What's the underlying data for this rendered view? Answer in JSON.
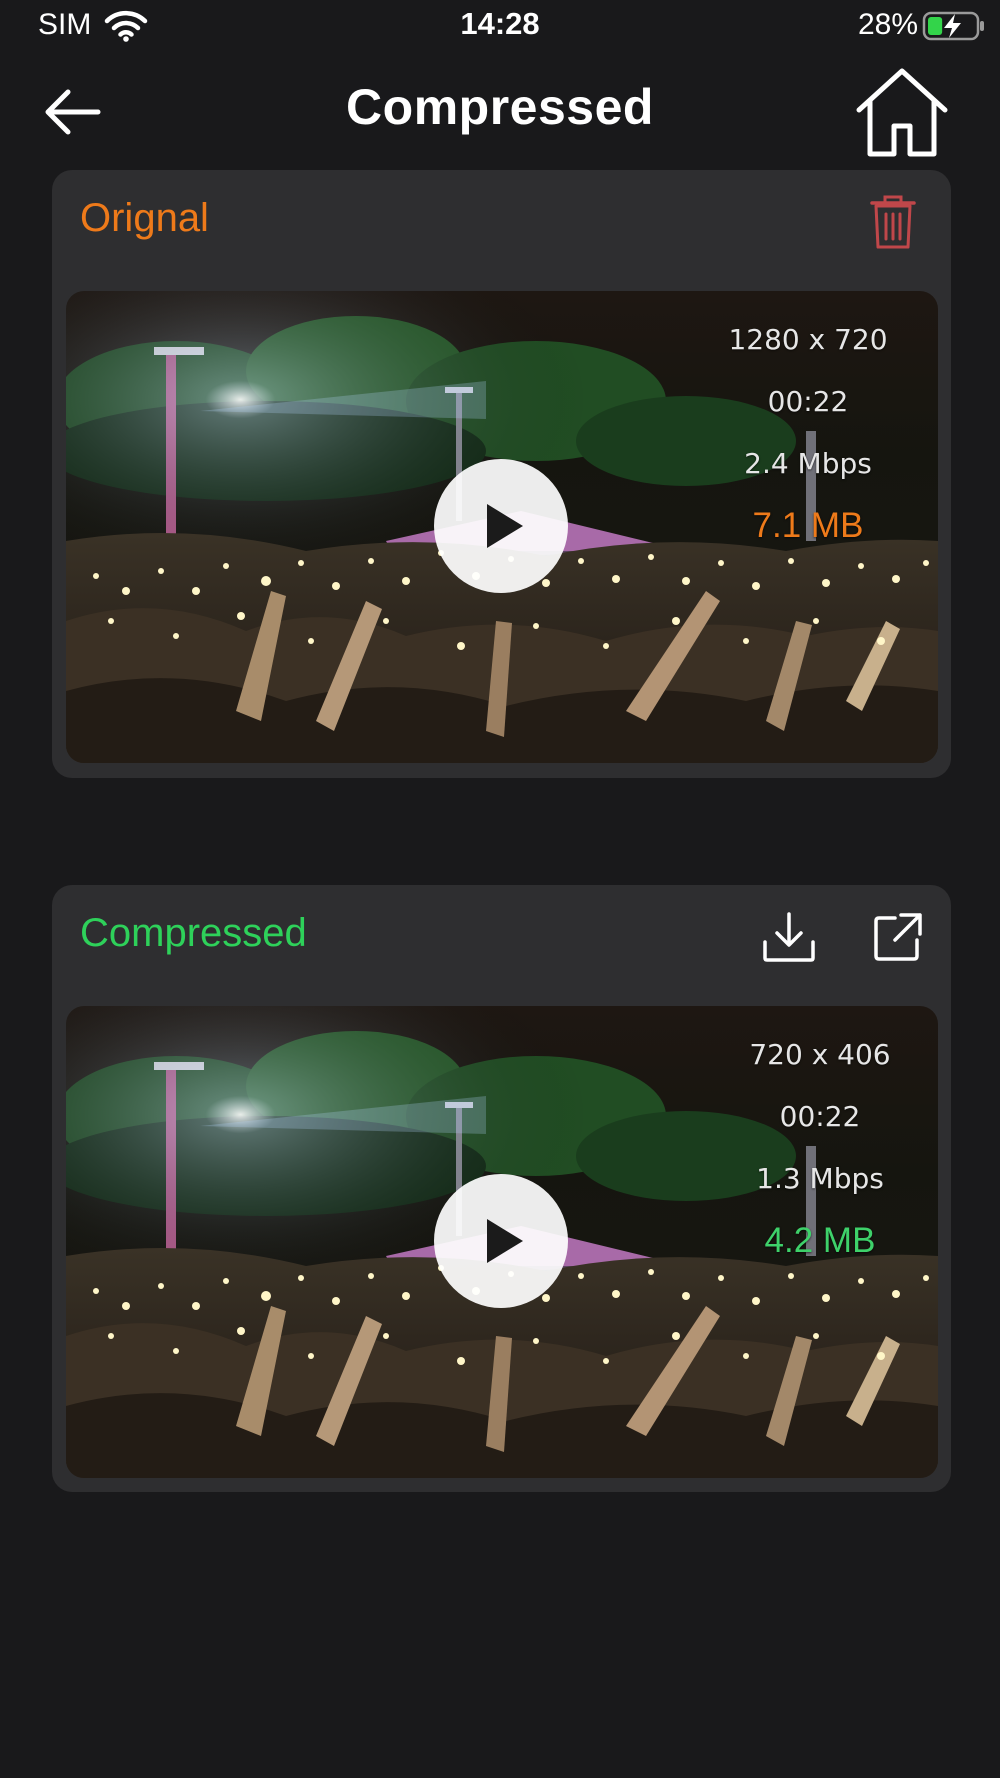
{
  "status_bar": {
    "carrier": "SIM",
    "time": "14:28",
    "battery_percent": "28%",
    "battery_level": 0.28,
    "charging": true
  },
  "nav": {
    "title": "Compressed",
    "back_icon": "arrow-left-icon",
    "home_icon": "home-icon"
  },
  "original": {
    "title": "Orignal",
    "title_color": "#ee7a1a",
    "resolution": "1280 x 720",
    "duration": "00:22",
    "bitrate": "2.4 Mbps",
    "size": "7.1 MB",
    "action_icon": "trash-icon"
  },
  "compressed": {
    "title": "Compressed",
    "title_color": "#2ed15a",
    "resolution": "720 x 406",
    "duration": "00:22",
    "bitrate": "1.3 Mbps",
    "size": "4.2 MB",
    "actions": [
      "download-icon",
      "share-icon"
    ]
  },
  "colors": {
    "background": "#19191b",
    "card": "#2e2e30",
    "accent_orange": "#ee7a1a",
    "accent_green": "#2ed15a",
    "delete_red": "#c0474a"
  }
}
